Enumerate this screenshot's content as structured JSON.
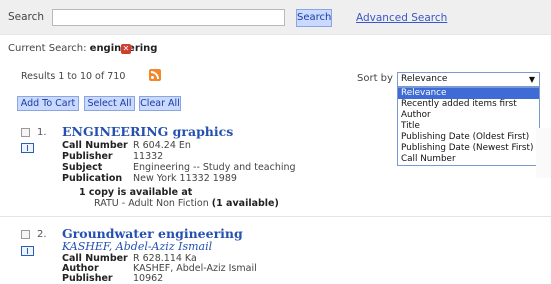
{
  "search": {
    "label": "Search",
    "input_value": "",
    "button_label": "Search",
    "advanced_link": "Advanced Search"
  },
  "current": {
    "label": "Current Search:",
    "term": "engineering"
  },
  "results": {
    "summary": "Results 1 to 10 of 710"
  },
  "sort": {
    "label": "Sort by",
    "selected": "Relevance",
    "options": [
      "Relevance",
      "Recently added items first",
      "Author",
      "Title",
      "Publishing Date (Oldest First)",
      "Publishing Date (Newest First)",
      "Call Number"
    ]
  },
  "actions": {
    "add_to_cart": "Add To Cart",
    "select_all": "Select All",
    "clear_all": "Clear All"
  },
  "records": [
    {
      "number": "1.",
      "title": "ENGINEERING graphics",
      "fields": [
        {
          "label": "Call Number",
          "value": "R 604.24 En"
        },
        {
          "label": "Publisher",
          "value": "11332"
        },
        {
          "label": "Subject",
          "value": "Engineering -- Study and teaching"
        },
        {
          "label": "Publication",
          "value": "New York 11332 1989"
        }
      ],
      "availability": "1 copy is available at",
      "location": "RATU - Adult Non Fiction",
      "location_count": "(1 available)"
    },
    {
      "number": "2.",
      "title": "Groundwater engineering",
      "author": "KASHEF, Abdel-Aziz Ismail",
      "fields": [
        {
          "label": "Call Number",
          "value": "R 628.114 Ka"
        },
        {
          "label": "Author",
          "value": "KASHEF, Abdel-Aziz Ismail"
        },
        {
          "label": "Publisher",
          "value": "10962"
        }
      ]
    }
  ]
}
